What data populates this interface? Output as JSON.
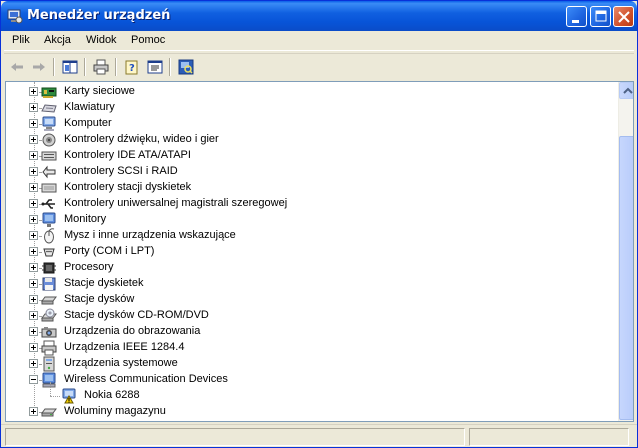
{
  "window": {
    "title": "Menedżer urządzeń",
    "accent": "#0A5FE8"
  },
  "menu": [
    "Plik",
    "Akcja",
    "Widok",
    "Pomoc"
  ],
  "toolbar": {
    "buttons": [
      "back-icon",
      "forward-icon",
      "show-hide-console-tree-icon",
      "print-icon",
      "properties-help-icon",
      "properties-icon",
      "scan-hardware-icon"
    ]
  },
  "tree": {
    "items": [
      {
        "label": "Karty sieciowe",
        "icon": "network-card-icon"
      },
      {
        "label": "Klawiatury",
        "icon": "keyboard-icon"
      },
      {
        "label": "Komputer",
        "icon": "computer-icon"
      },
      {
        "label": "Kontrolery dźwięku, wideo i gier",
        "icon": "sound-icon"
      },
      {
        "label": "Kontrolery IDE ATA/ATAPI",
        "icon": "ide-controller-icon"
      },
      {
        "label": "Kontrolery SCSI i RAID",
        "icon": "scsi-icon"
      },
      {
        "label": "Kontrolery stacji dyskietek",
        "icon": "floppy-controller-icon"
      },
      {
        "label": "Kontrolery uniwersalnej magistrali szeregowej",
        "icon": "usb-icon"
      },
      {
        "label": "Monitory",
        "icon": "monitor-icon"
      },
      {
        "label": "Mysz i inne urządzenia wskazujące",
        "icon": "mouse-icon"
      },
      {
        "label": "Porty (COM i LPT)",
        "icon": "port-icon"
      },
      {
        "label": "Procesory",
        "icon": "processor-icon"
      },
      {
        "label": "Stacje dyskietek",
        "icon": "floppy-drive-icon"
      },
      {
        "label": "Stacje dysków",
        "icon": "disk-drive-icon"
      },
      {
        "label": "Stacje dysków CD-ROM/DVD",
        "icon": "cdrom-icon"
      },
      {
        "label": "Urządzenia do obrazowania",
        "icon": "imaging-icon"
      },
      {
        "label": "Urządzenia IEEE 1284.4",
        "icon": "ieee-icon"
      },
      {
        "label": "Urządzenia systemowe",
        "icon": "system-device-icon"
      },
      {
        "label": "Wireless Communication Devices",
        "icon": "wireless-device-icon",
        "expanded": true,
        "children": [
          {
            "label": "Nokia 6288",
            "icon": "warning-device-icon",
            "status": "warning"
          }
        ]
      },
      {
        "label": "Woluminy magazynu",
        "icon": "storage-volume-icon"
      }
    ]
  },
  "statusbar": {
    "text": ""
  }
}
